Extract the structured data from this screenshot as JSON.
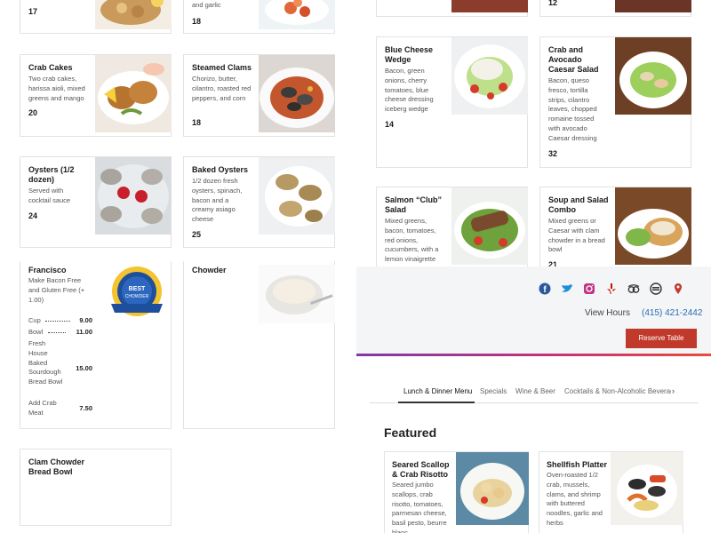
{
  "left_column": {
    "cards": [
      {
        "id": "top-left",
        "title": "",
        "desc": "",
        "price": "17"
      },
      {
        "id": "top-right",
        "title": "",
        "desc": "and garlic",
        "price": "18"
      },
      {
        "id": "crab-cakes",
        "title": "Crab Cakes",
        "desc": "Two crab cakes, harissa aioli, mixed greens and mango",
        "price": "20"
      },
      {
        "id": "steamed-clams",
        "title": "Steamed Clams",
        "desc": "Chorizo, butter, cilantro, roasted red peppers, and corn",
        "price": "18"
      },
      {
        "id": "oysters",
        "title": "Oysters (1/2 dozen)",
        "desc": "Served with cocktail sauce",
        "price": "24"
      },
      {
        "id": "baked-oysters",
        "title": "Baked Oysters",
        "desc": "1/2 dozen fresh oysters, spinach, bacon and a creamy asiago cheese",
        "price": "25"
      },
      {
        "id": "francisco",
        "title": "Francisco",
        "desc": "Make Bacon Free and Gluten Free (+ 1.00)",
        "price": ""
      },
      {
        "id": "chowder",
        "title": "Chowder",
        "desc": "",
        "price": ""
      },
      {
        "id": "clam-chowder-bowl",
        "title": "Clam Chowder Bread Bowl",
        "desc": "",
        "price": ""
      }
    ],
    "chowder_options": [
      {
        "label": "Cup",
        "price": "9.00",
        "dots": true
      },
      {
        "label": "Bowl",
        "price": "11.00",
        "dots": true
      },
      {
        "label": "Fresh House Baked Sourdough Bread Bowl",
        "price": "15.00",
        "dots": false
      },
      {
        "label": "Add Crab Meat",
        "price": "7.50",
        "dots": false
      }
    ]
  },
  "right_column": {
    "top_prices": {
      "right": "12"
    },
    "cards": [
      {
        "id": "blue-cheese",
        "title": "Blue Cheese Wedge",
        "desc": "Bacon, green onions, cherry tomatoes, blue cheese dressing iceberg wedge",
        "price": "14"
      },
      {
        "id": "crab-avocado",
        "title": "Crab and Avocado Caesar Salad",
        "desc": "Bacon, queso fresco, tortilla strips, cilantro leaves, chopped romaine tossed with avocado Caesar dressing",
        "price": "32"
      },
      {
        "id": "salmon-club",
        "title": "Salmon “Club” Salad",
        "desc": "Mixed greens, bacon, tomatoes, red onions, cucumbers, with a lemon vinaigrette",
        "price": ""
      },
      {
        "id": "soup-salad",
        "title": "Soup and Salad Combo",
        "desc": "Mixed greens or Caesar with clam chowder in a bread bowl",
        "price": "21"
      }
    ]
  },
  "header": {
    "view_hours": "View Hours",
    "phone": "(415) 421-2442",
    "reserve": "Reserve Table",
    "social": [
      "facebook-icon",
      "twitter-icon",
      "instagram-icon",
      "yelp-icon",
      "tripadvisor-icon",
      "opentable-icon",
      "location-pin-icon"
    ]
  },
  "tabs": [
    "Lunch & Dinner Menu",
    "Specials",
    "Wine & Beer",
    "Cocktails & Non-Alcoholic Beverages"
  ],
  "featured": {
    "heading": "Featured",
    "items": [
      {
        "title": "Seared Scallop & Crab Risotto",
        "desc": "Seared jumbo scallops, crab risotto, tomatoes, parmesan cheese, basil pesto, beurre blanc"
      },
      {
        "title": "Shellfish Platter",
        "desc": "Oven-roasted 1/2 crab, mussels, clams, and shrimp with buttered noodles, garlic and herbs"
      }
    ]
  },
  "colors": {
    "accent": "#c0392b",
    "link": "#2a6ab5",
    "brand_gradient": [
      "#8e44ad",
      "#e74c3c"
    ]
  }
}
